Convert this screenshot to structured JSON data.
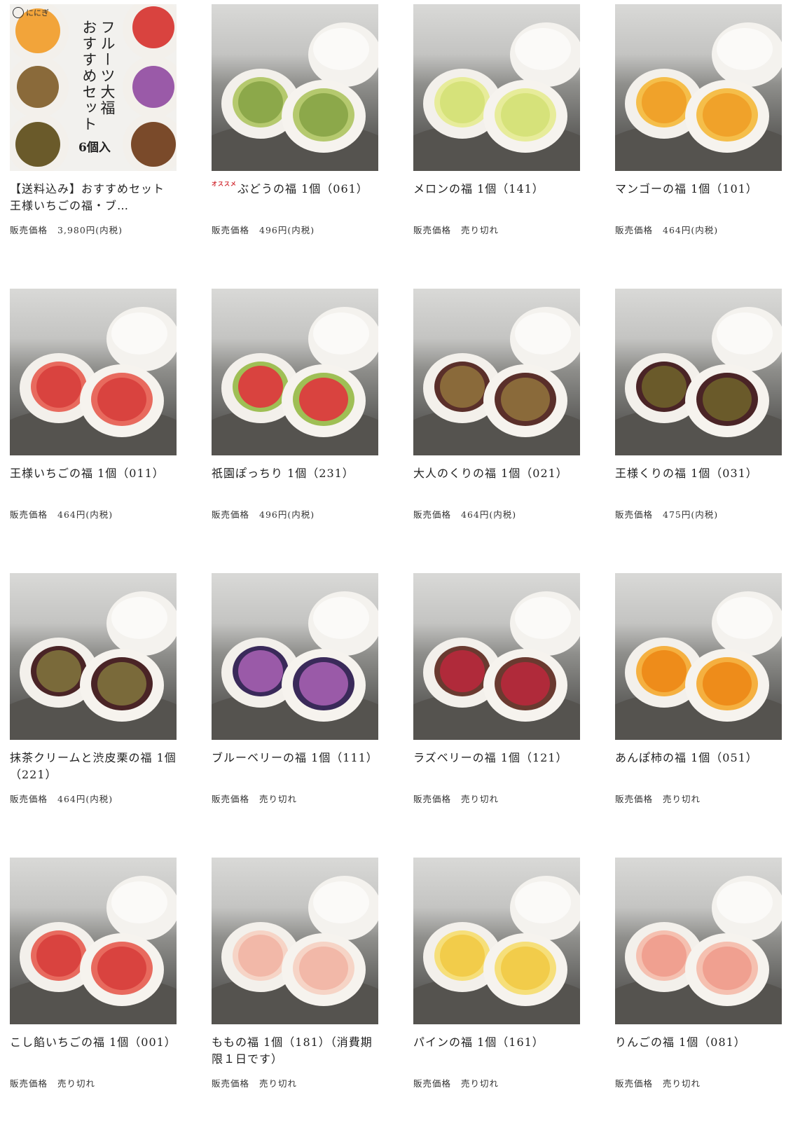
{
  "price_label": "販売価格",
  "hero": {
    "logo_text": "ににぎ",
    "title_line1": "フルーツ大福",
    "title_line2": "おすすめセット",
    "count": "6個入"
  },
  "products": [
    {
      "title": "【送料込み】おすすめセット　王様いちごの福・ブ…",
      "price": "3,980円(内税)",
      "badge": "",
      "fill": "hero"
    },
    {
      "title": "ぶどうの福 1個（061）",
      "price": "496円(内税)",
      "badge": "オススメ",
      "fill": "#8ca84a",
      "fill2": "#b5c96e"
    },
    {
      "title": "メロンの福 1個（141）",
      "price": "売り切れ",
      "badge": "",
      "fill": "#d6e27a",
      "fill2": "#e7ec9a"
    },
    {
      "title": "マンゴーの福 1個（101）",
      "price": "464円(内税)",
      "badge": "",
      "fill": "#f0a22a",
      "fill2": "#f5be4a"
    },
    {
      "title": "王様いちごの福 1個（011）",
      "price": "464円(内税)",
      "badge": "",
      "fill": "#d9433f",
      "fill2": "#e86a5e"
    },
    {
      "title": "祇園ぽっちり 1個（231）",
      "price": "496円(内税)",
      "badge": "",
      "fill": "#d9433f",
      "fill2": "#9fbf55"
    },
    {
      "title": "大人のくりの福 1個（021）",
      "price": "464円(内税)",
      "badge": "",
      "fill": "#8a6a3a",
      "fill2": "#5a2f2a"
    },
    {
      "title": "王様くりの福 1個（031）",
      "price": "475円(内税)",
      "badge": "",
      "fill": "#6a5a2a",
      "fill2": "#4a2426"
    },
    {
      "title": "抹茶クリームと渋皮栗の福 1個（221）",
      "price": "464円(内税)",
      "badge": "",
      "fill": "#7a6a3a",
      "fill2": "#4a2426"
    },
    {
      "title": "ブルーベリーの福 1個（111）",
      "price": "売り切れ",
      "badge": "",
      "fill": "#9a5aa8",
      "fill2": "#3a2a5a"
    },
    {
      "title": "ラズベリーの福 1個（121）",
      "price": "売り切れ",
      "badge": "",
      "fill": "#b02a3a",
      "fill2": "#6a3a30"
    },
    {
      "title": "あんぽ柿の福 1個（051）",
      "price": "売り切れ",
      "badge": "",
      "fill": "#ee8c1a",
      "fill2": "#f5b040"
    },
    {
      "title": "こし餡いちごの福 1個（001）",
      "price": "売り切れ",
      "badge": "",
      "fill": "#d9433f",
      "fill2": "#e86a5e"
    },
    {
      "title": "ももの福 1個（181）（消費期限１日です）",
      "price": "売り切れ",
      "badge": "",
      "fill": "#f2b8a8",
      "fill2": "#f6d4c6"
    },
    {
      "title": "パインの福 1個（161）",
      "price": "売り切れ",
      "badge": "",
      "fill": "#f2cc4a",
      "fill2": "#f6df7a"
    },
    {
      "title": "りんごの福 1個（081）",
      "price": "売り切れ",
      "badge": "",
      "fill": "#f0a090",
      "fill2": "#f5c0b0"
    }
  ]
}
